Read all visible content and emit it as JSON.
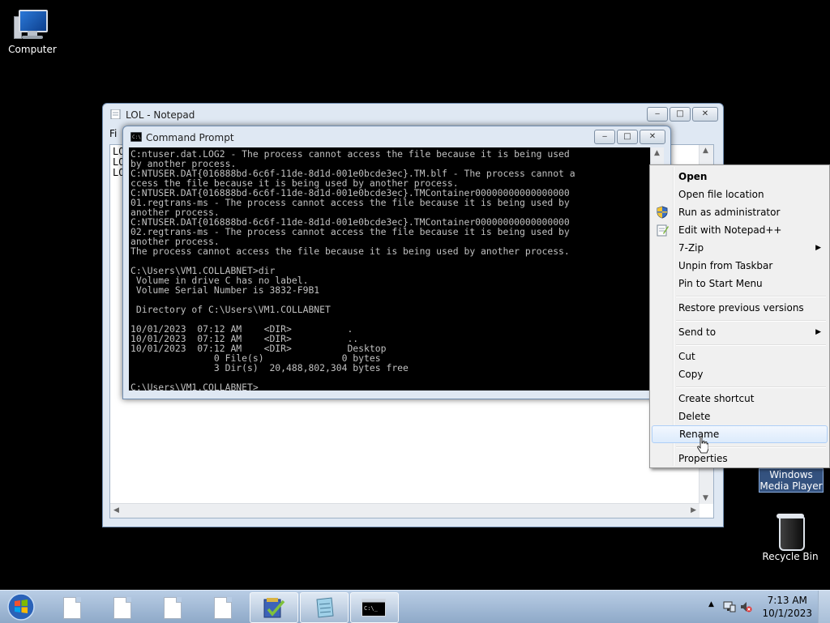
{
  "desktop": {
    "icons": {
      "computer": "Computer",
      "recycle_bin": "Recycle Bin",
      "wmp_line1": "Windows",
      "wmp_line2": "Media Player"
    }
  },
  "notepad": {
    "title": "LOL - Notepad",
    "menu_partial": "Fi",
    "lines": [
      "LO",
      "LO",
      "LO"
    ]
  },
  "cmd": {
    "title": "Command Prompt",
    "output": "C:ntuser.dat.LOG2 - The process cannot access the file because it is being used\nby another process.\nC:NTUSER.DAT{016888bd-6c6f-11de-8d1d-001e0bcde3ec}.TM.blf - The process cannot a\nccess the file because it is being used by another process.\nC:NTUSER.DAT{016888bd-6c6f-11de-8d1d-001e0bcde3ec}.TMContainer00000000000000000\n01.regtrans-ms - The process cannot access the file because it is being used by\nanother process.\nC:NTUSER.DAT{016888bd-6c6f-11de-8d1d-001e0bcde3ec}.TMContainer00000000000000000\n02.regtrans-ms - The process cannot access the file because it is being used by\nanother process.\nThe process cannot access the file because it is being used by another process.\n\nC:\\Users\\VM1.COLLABNET>dir\n Volume in drive C has no label.\n Volume Serial Number is 3832-F9B1\n\n Directory of C:\\Users\\VM1.COLLABNET\n\n10/01/2023  07:12 AM    <DIR>          .\n10/01/2023  07:12 AM    <DIR>          ..\n10/01/2023  07:12 AM    <DIR>          Desktop\n               0 File(s)              0 bytes\n               3 Dir(s)  20,488,802,304 bytes free\n\nC:\\Users\\VM1.COLLABNET>"
  },
  "context_menu": {
    "open": "Open",
    "open_file_location": "Open file location",
    "run_as_admin": "Run as administrator",
    "edit_notepadpp": "Edit with Notepad++",
    "seven_zip": "7-Zip",
    "unpin_taskbar": "Unpin from Taskbar",
    "pin_start": "Pin to Start Menu",
    "restore_versions": "Restore previous versions",
    "send_to": "Send to",
    "cut": "Cut",
    "copy": "Copy",
    "create_shortcut": "Create shortcut",
    "delete": "Delete",
    "rename": "Rename",
    "properties": "Properties",
    "highlighted": "Rename"
  },
  "taskbar": {
    "clock_time": "7:13 AM",
    "clock_date": "10/1/2023",
    "pinned": [
      "document-icon",
      "document-icon",
      "document-icon",
      "document-icon",
      "checklist-app-icon",
      "notepad-icon",
      "command-prompt-icon"
    ]
  },
  "colors": {
    "highlight_border": "#aecff7",
    "console_bg": "#000000",
    "console_text": "#c0c0c0",
    "taskbar": "#a6bdd9"
  }
}
